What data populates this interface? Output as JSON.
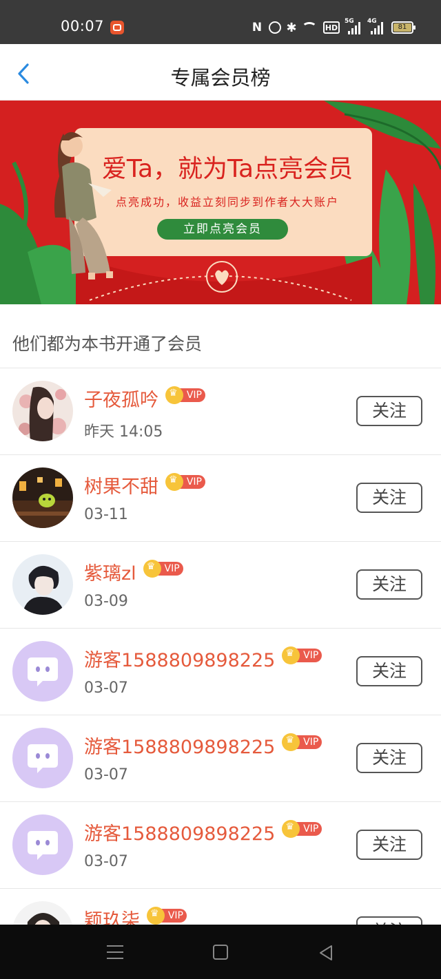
{
  "status_bar": {
    "time": "00:07",
    "battery": "81",
    "network_a": "5G",
    "network_b": "4G",
    "hd_label": "HD"
  },
  "header": {
    "title": "专属会员榜"
  },
  "banner": {
    "headline": "爱Ta，就为Ta点亮会员",
    "subtitle": "点亮成功，收益立刻同步到作者大大账户",
    "cta_label": "立即点亮会员"
  },
  "section": {
    "label": "他们都为本书开通了会员"
  },
  "vip_label": "VIP",
  "follow_label": "关注",
  "members": [
    {
      "name": "子夜孤吟",
      "date": "昨天 14:05",
      "avatar": "flower-portrait"
    },
    {
      "name": "树果不甜",
      "date": "03-11",
      "avatar": "night-scene"
    },
    {
      "name": "紫璃zl",
      "date": "03-09",
      "avatar": "boy-portrait"
    },
    {
      "name": "游客1588809898225",
      "date": "03-07",
      "avatar": "default-chat"
    },
    {
      "name": "游客1588809898225",
      "date": "03-07",
      "avatar": "default-chat"
    },
    {
      "name": "游客1588809898225",
      "date": "03-07",
      "avatar": "default-chat"
    },
    {
      "name": "颖玖柒",
      "date": "",
      "avatar": "girl-portrait"
    }
  ],
  "colors": {
    "accent_name": "#e55a3c",
    "banner_red": "#d42020",
    "vip_badge": "#ea5a4c",
    "crown_gold": "#f7c43a",
    "back_blue": "#2a8ae0",
    "default_avatar": "#d8c8f5"
  }
}
